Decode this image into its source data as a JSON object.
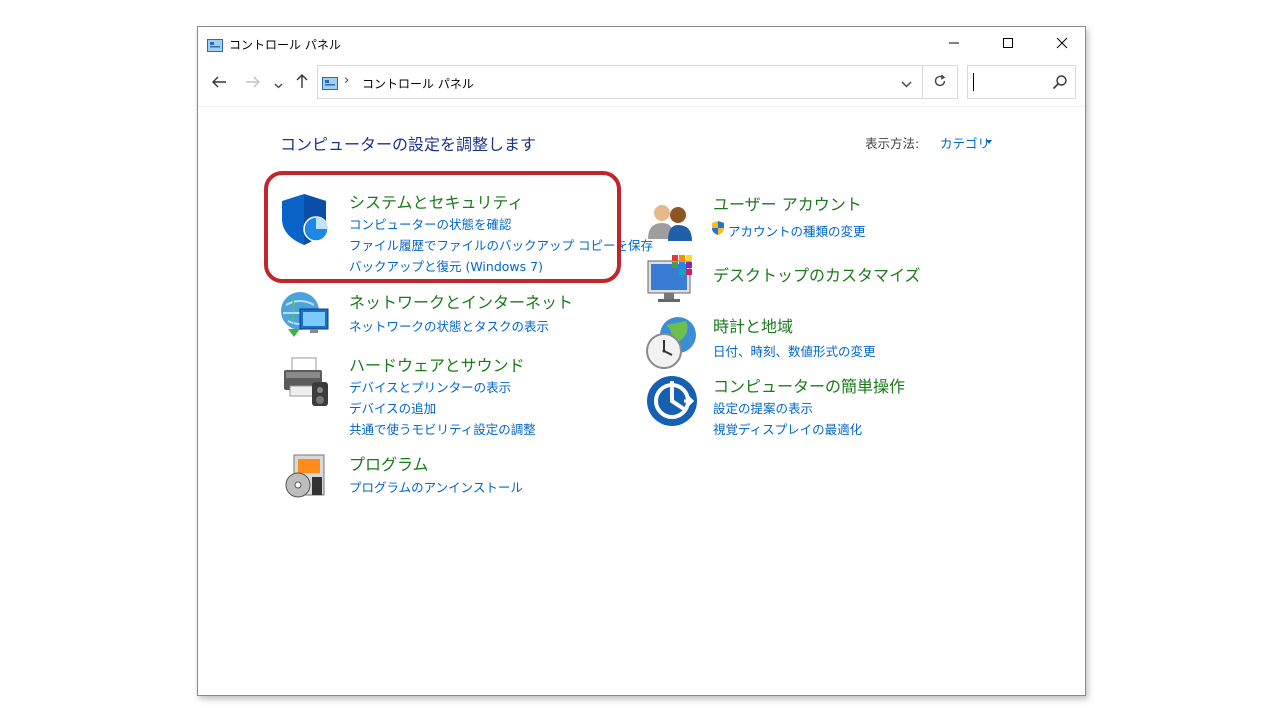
{
  "window": {
    "title": "コントロール パネル",
    "minimize_icon": "minimize-icon",
    "maximize_icon": "maximize-icon",
    "close_icon": "close-icon"
  },
  "navigation": {
    "back_icon": "arrow-left-icon",
    "forward_icon": "arrow-right-icon",
    "recent_icon": "chevron-down-icon",
    "up_icon": "arrow-up-icon",
    "address": {
      "separator": "›",
      "location": "コントロール パネル"
    },
    "refresh_icon": "refresh-icon",
    "search": {
      "value": "",
      "placeholder": ""
    }
  },
  "content": {
    "heading": "コンピューターの設定を調整します",
    "view_by_label": "表示方法:",
    "view_by_value": "カテゴリ"
  },
  "categories_left": [
    {
      "title": "システムとセキュリティ",
      "icon": "shield-icon",
      "links": [
        "コンピューターの状態を確認",
        "ファイル履歴でファイルのバックアップ コピーを保存",
        "バックアップと復元 (Windows 7)"
      ]
    },
    {
      "title": "ネットワークとインターネット",
      "icon": "network-icon",
      "links": [
        "ネットワークの状態とタスクの表示"
      ]
    },
    {
      "title": "ハードウェアとサウンド",
      "icon": "printer-icon",
      "links": [
        "デバイスとプリンターの表示",
        "デバイスの追加",
        "共通で使うモビリティ設定の調整"
      ]
    },
    {
      "title": "プログラム",
      "icon": "program-disc-icon",
      "links": [
        "プログラムのアンインストール"
      ]
    }
  ],
  "categories_right": [
    {
      "title": "ユーザー アカウント",
      "icon": "users-icon",
      "links": [
        "アカウントの種類の変更"
      ]
    },
    {
      "title": "デスクトップのカスタマイズ",
      "icon": "monitor-palette-icon",
      "links": []
    },
    {
      "title": "時計と地域",
      "icon": "clock-globe-icon",
      "links": [
        "日付、時刻、数値形式の変更"
      ]
    },
    {
      "title": "コンピューターの簡単操作",
      "icon": "ease-of-access-icon",
      "links": [
        "設定の提案の表示",
        "視覚ディスプレイの最適化"
      ]
    }
  ],
  "colors": {
    "category_title": "#1a7a1a",
    "link": "#0066cc",
    "heading": "#1e3287",
    "highlight_border": "#c0262c"
  }
}
